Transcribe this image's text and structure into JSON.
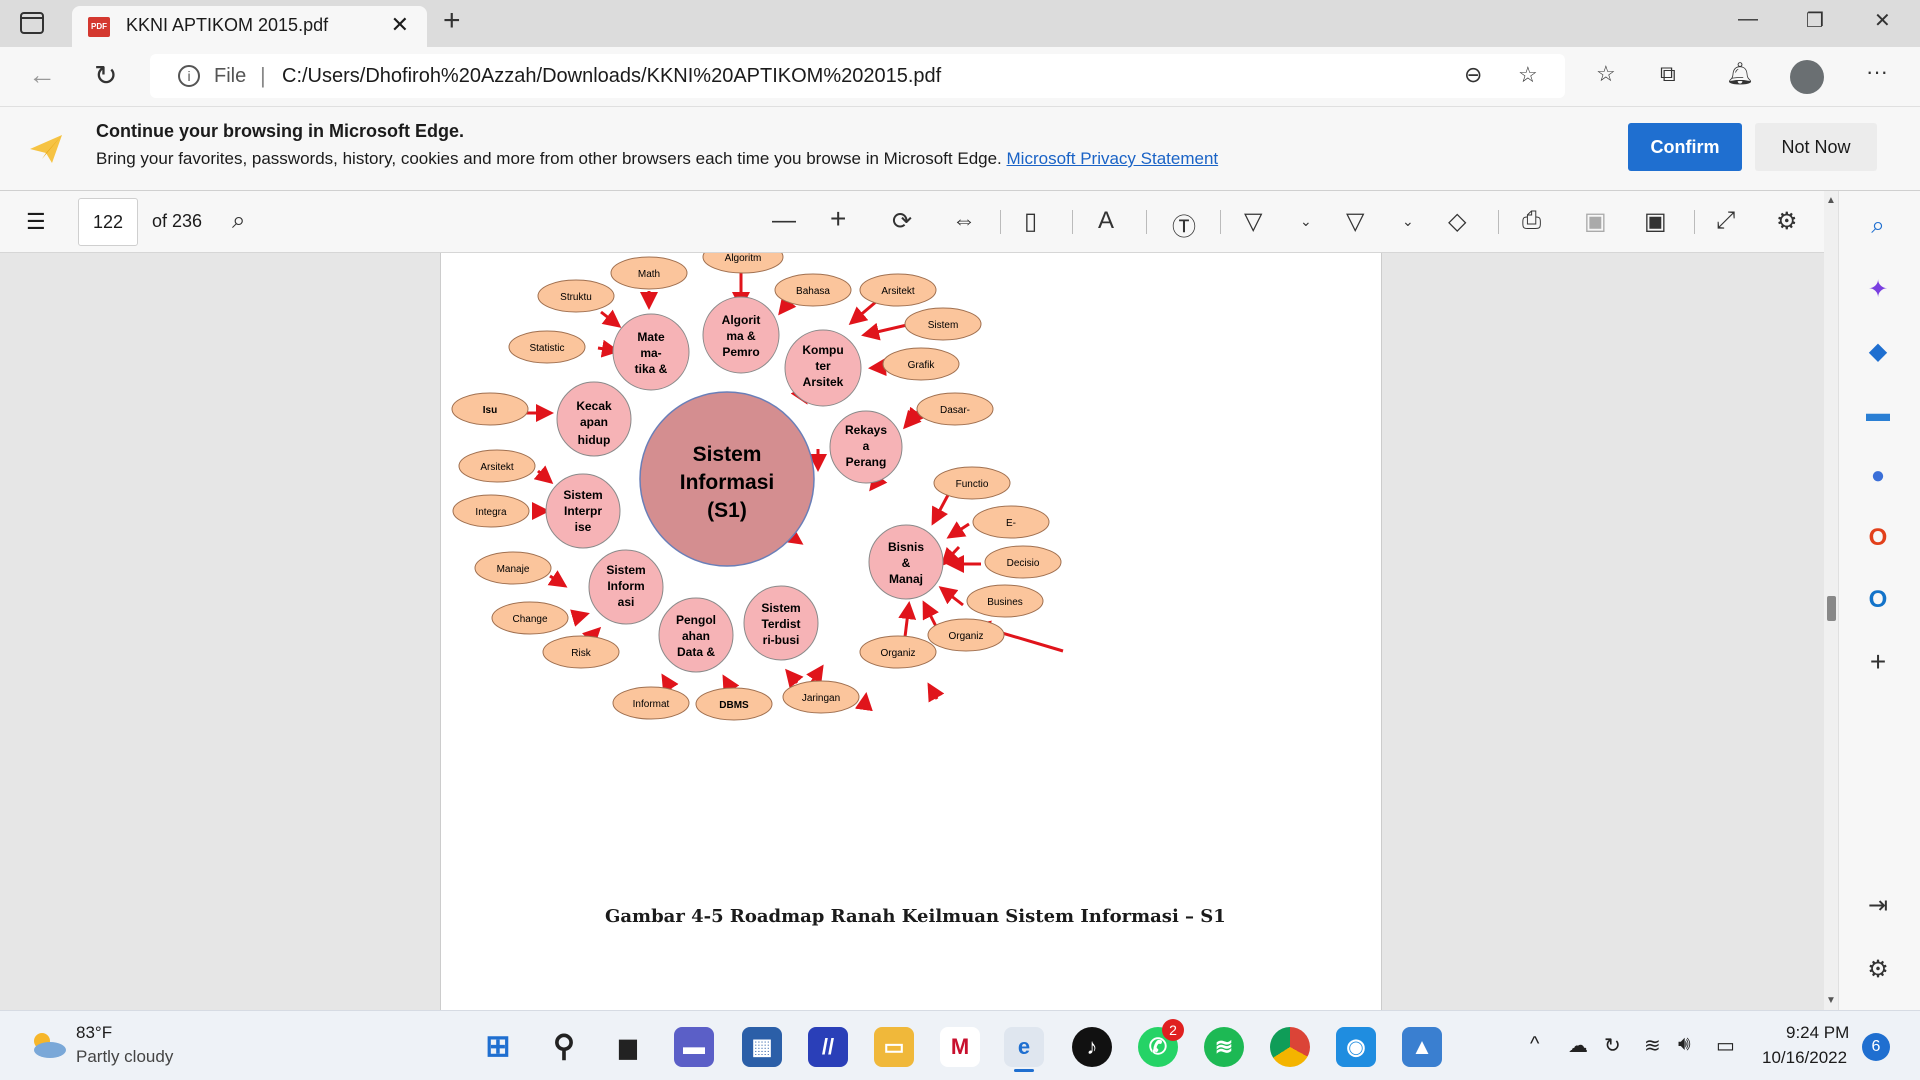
{
  "browser": {
    "tab_title": "KKNI APTIKOM 2015.pdf",
    "address_scheme": "File",
    "url": "C:/Users/Dhofiroh%20Azzah/Downloads/KKNI%20APTIKOM%202015.pdf"
  },
  "infobar": {
    "heading": "Continue your browsing in Microsoft Edge.",
    "description": "Bring your favorites, passwords, history, cookies and more from other browsers each time you browse in Microsoft Edge.",
    "link": "Microsoft Privacy Statement",
    "confirm": "Confirm",
    "not_now": "Not Now"
  },
  "pdf_toolbar": {
    "page": "122",
    "of_pages": "of 236"
  },
  "diagram": {
    "center": [
      "Sistem",
      "Informasi",
      "(S1)"
    ],
    "topics": {
      "mate": [
        "Mate",
        "ma-",
        "tika &"
      ],
      "algo": [
        "Algorit",
        "ma &",
        "Pemro"
      ],
      "komp": [
        "Kompu",
        "ter",
        "Arsitek"
      ],
      "rekays": [
        "Rekays",
        "a",
        "Perang"
      ],
      "bisnis": [
        "Bisnis",
        "&",
        "Manaj"
      ],
      "terdist": [
        "Sistem",
        "Terdist",
        "ri-busi"
      ],
      "pengol": [
        "Pengol",
        "ahan",
        "Data &"
      ],
      "sisinf": [
        "Sistem",
        "Inform",
        "asi"
      ],
      "interp": [
        "Sistem",
        "Interpr",
        "ise"
      ],
      "kecak": [
        "Kecak",
        "apan",
        "hidup"
      ]
    },
    "subtopics": {
      "algoritm": "Algoritm",
      "math": "Math",
      "struktu": "Struktu",
      "statistic": "Statistic",
      "bahasa": "Bahasa",
      "arsitekt1": "Arsitekt",
      "sistem": "Sistem",
      "grafik": "Grafik",
      "dasar": "Dasar-",
      "isu": "Isu",
      "arsitekt2": "Arsitekt",
      "integra": "Integra",
      "functio": "Functio",
      "e": "E-",
      "decisio": "Decisio",
      "busines": "Busines",
      "organiz1": "Organiz",
      "organiz2": "Organiz",
      "manaje": "Manaje",
      "change": "Change",
      "risk": "Risk",
      "informat": "Informat",
      "dbms": "DBMS",
      "jaringan": "Jaringan"
    },
    "caption": "Gambar 4-5  Roadmap Ranah Keilmuan Sistem Informasi – S1",
    "colors": {
      "center_fill": "#d48e90",
      "topic_fill": "#f6b3b6",
      "leaf_fill": "#fbc59c",
      "arrow": "#e0141b"
    }
  },
  "taskbar": {
    "temperature": "83°F",
    "condition": "Partly cloudy",
    "whatsapp_badge": "2",
    "time": "9:24 PM",
    "date": "10/16/2022",
    "notifications": "6"
  }
}
